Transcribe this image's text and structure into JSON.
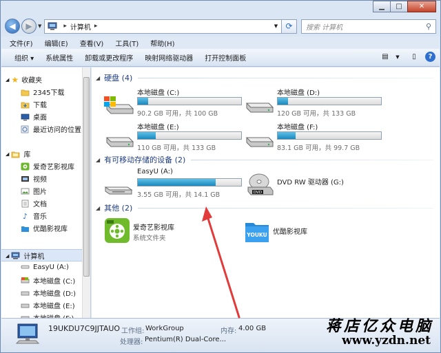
{
  "window": {
    "caption": {
      "minimize": "▁",
      "maximize": "□",
      "close": "✕"
    }
  },
  "address": {
    "root_sep": "▸",
    "crumb": "计算机",
    "crumb_sep": "▸",
    "search_placeholder": "搜索 计算机"
  },
  "menu": [
    "文件(F)",
    "编辑(E)",
    "查看(V)",
    "工具(T)",
    "帮助(H)"
  ],
  "toolbar": {
    "items": [
      "组织 ▾",
      "系统属性",
      "卸载或更改程序",
      "映射网络驱动器",
      "打开控制面板"
    ]
  },
  "nav": {
    "favorites": "收藏夹",
    "fav_items": [
      "2345下载",
      "下载",
      "桌面",
      "最近访问的位置"
    ],
    "library": "库",
    "lib_items": [
      "爱奇艺影视库",
      "视频",
      "图片",
      "文档",
      "音乐",
      "优酷影视库"
    ],
    "computer": "计算机",
    "comp_items": [
      "EasyU (A:)",
      "本地磁盘 (C:)",
      "本地磁盘 (D:)",
      "本地磁盘 (E:)",
      "本地磁盘 (F:)"
    ]
  },
  "content": {
    "hdd_head": "硬盘 (4)",
    "removable_head": "有可移动存储的设备 (2)",
    "other_head": "其他 (2)",
    "drives": [
      {
        "name": "本地磁盘 (C:)",
        "sub": "90.2 GB 可用，共 100 GB",
        "used_fraction": 0.1
      },
      {
        "name": "本地磁盘 (D:)",
        "sub": "120 GB 可用，共 133 GB",
        "used_fraction": 0.1
      },
      {
        "name": "本地磁盘 (E:)",
        "sub": "110 GB 可用，共 133 GB",
        "used_fraction": 0.17
      },
      {
        "name": "本地磁盘 (F:)",
        "sub": "83.1 GB 可用，共 99.7 GB",
        "used_fraction": 0.17
      }
    ],
    "usb": {
      "name": "EasyU (A:)",
      "sub": "3.55 GB 可用，共 14.1 GB",
      "used_fraction": 0.75
    },
    "dvd": {
      "name": "DVD RW 驱动器 (G:)",
      "badge": "DVD"
    },
    "others": [
      {
        "name": "爱奇艺影视库",
        "sub": "系统文件夹"
      },
      {
        "name": "优酷影视库",
        "sub": ""
      }
    ],
    "youku_logo": "YOUKU"
  },
  "details": {
    "pc_name": "19UKDU7C9JJTAUO",
    "workgroup_label": "工作组:",
    "workgroup": "WorkGroup",
    "memory_label": "内存:",
    "memory": "4.00 GB",
    "cpu_label": "处理器:",
    "cpu": "Pentium(R) Dual-Core..."
  },
  "watermark": {
    "cn": "蒋店亿众电脑",
    "url": "www.yzdn.net"
  },
  "colors": {
    "accent_blue": "#1e3c87",
    "bar_fill": "#1a88bd",
    "arrow_red": "#e23b3b"
  }
}
